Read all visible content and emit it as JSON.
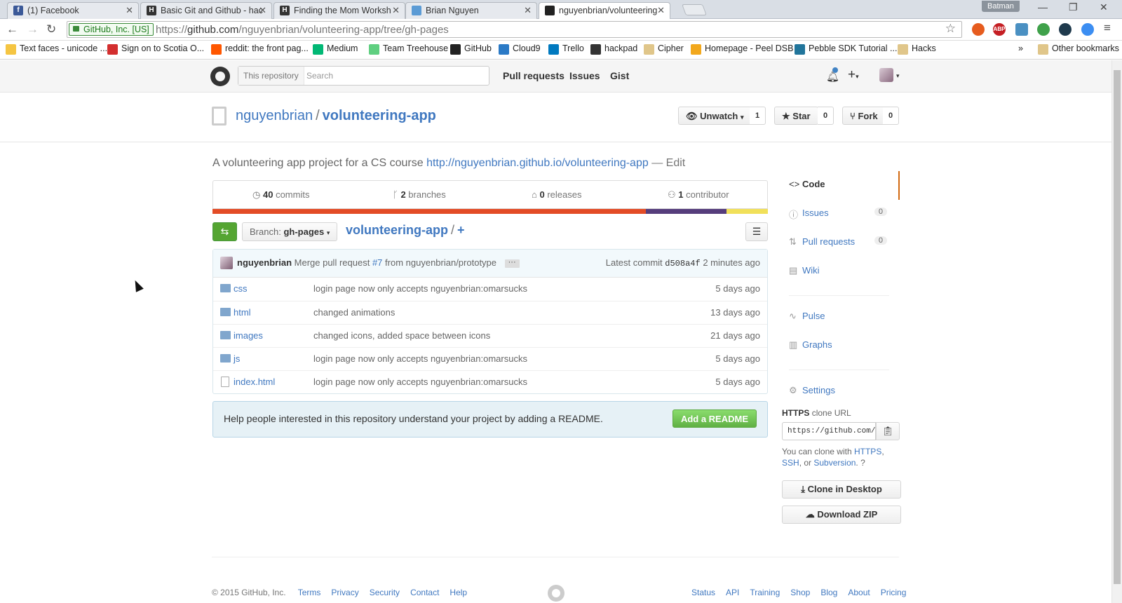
{
  "browser": {
    "tabs": [
      {
        "title": "(1) Facebook",
        "favicon": "facebook-icon",
        "color": "#3b5998",
        "glyph": "f"
      },
      {
        "title": "Basic Git and Github - hac",
        "favicon": "hackpad-icon",
        "color": "#333333",
        "glyph": "H"
      },
      {
        "title": "Finding the Mom Worksh",
        "favicon": "hackpad-icon",
        "color": "#333333",
        "glyph": "H"
      },
      {
        "title": "Brian Nguyen",
        "favicon": "photo-icon",
        "color": "#5b9bd5",
        "glyph": ""
      },
      {
        "title": "nguyenbrian/volunteering",
        "favicon": "github-icon",
        "color": "#222222",
        "glyph": ""
      }
    ],
    "profile_name": "Batman",
    "secure_label": "GitHub, Inc. [US]",
    "url_scheme": "https://",
    "url_host": "github.com",
    "url_path": "/nguyenbrian/volunteering-app/tree/gh-pages",
    "bookmarks": [
      {
        "label": "Text faces - unicode ...",
        "icon": "emoji-icon",
        "color": "#f5c542"
      },
      {
        "label": "Sign on to Scotia O...",
        "icon": "scotia-icon",
        "color": "#d32f2f"
      },
      {
        "label": "reddit: the front pag...",
        "icon": "reddit-icon",
        "color": "#ff5700"
      },
      {
        "label": "Medium",
        "icon": "medium-icon",
        "color": "#02b875"
      },
      {
        "label": "Team Treehouse",
        "icon": "treehouse-icon",
        "color": "#5fcf80"
      },
      {
        "label": "GitHub",
        "icon": "github-icon",
        "color": "#222222"
      },
      {
        "label": "Cloud9",
        "icon": "cloud9-icon",
        "color": "#2b7ac6"
      },
      {
        "label": "Trello",
        "icon": "trello-icon",
        "color": "#0079bf"
      },
      {
        "label": "hackpad",
        "icon": "hackpad-icon",
        "color": "#333333"
      },
      {
        "label": "Cipher",
        "icon": "folder-icon",
        "color": "#e0c68a"
      },
      {
        "label": "Homepage - Peel DSB",
        "icon": "peel-icon",
        "color": "#f2a81d"
      },
      {
        "label": "Pebble SDK Tutorial ...",
        "icon": "wordpress-icon",
        "color": "#21759b"
      },
      {
        "label": "Hacks",
        "icon": "folder-icon",
        "color": "#e0c68a"
      }
    ],
    "bookmarks_overflow": "»",
    "other_bookmarks": "Other bookmarks"
  },
  "header": {
    "search_scope": "This repository",
    "search_placeholder": "Search",
    "nav": [
      "Pull requests",
      "Issues",
      "Gist"
    ]
  },
  "repo": {
    "owner": "nguyenbrian",
    "name": "volunteering-app",
    "watch_label": "Unwatch",
    "watch_count": "1",
    "star_label": "Star",
    "star_count": "0",
    "fork_label": "Fork",
    "fork_count": "0",
    "description": "A volunteering app project for a CS course",
    "homepage": "http://nguyenbrian.github.io/volunteering-app",
    "edit_label": "— Edit"
  },
  "summary": {
    "commits_count": "40",
    "commits_label": "commits",
    "branches_count": "2",
    "branches_label": "branches",
    "releases_count": "0",
    "releases_label": "releases",
    "contributors_count": "1",
    "contributors_label": "contributor"
  },
  "languages": [
    {
      "share": 0.78,
      "color": "#e34c26"
    },
    {
      "share": 0.145,
      "color": "#563d7c"
    },
    {
      "share": 0.075,
      "color": "#f1e05a"
    }
  ],
  "file_nav": {
    "branch_prefix": "Branch:",
    "branch": "gh-pages",
    "root": "volunteering-app",
    "separator": "/",
    "add": "+"
  },
  "latest_commit": {
    "author": "nguyenbrian",
    "message_pre": "Merge pull request",
    "pr_link": "#7",
    "message_post": "from nguyenbrian/prototype",
    "ellipsis": "···",
    "label": "Latest commit",
    "sha": "d508a4f",
    "age": "2 minutes ago"
  },
  "files": [
    {
      "name": "css",
      "type": "dir",
      "message": "login page now only accepts nguyenbrian:omarsucks",
      "age": "5 days ago"
    },
    {
      "name": "html",
      "type": "dir",
      "message": "changed animations",
      "age": "13 days ago"
    },
    {
      "name": "images",
      "type": "dir",
      "message": "changed icons, added space between icons",
      "age": "21 days ago"
    },
    {
      "name": "js",
      "type": "dir",
      "message": "login page now only accepts nguyenbrian:omarsucks",
      "age": "5 days ago"
    },
    {
      "name": "index.html",
      "type": "file",
      "message": "login page now only accepts nguyenbrian:omarsucks",
      "age": "5 days ago"
    }
  ],
  "readme_prompt": {
    "text": "Help people interested in this repository understand your project by adding a README.",
    "button": "Add a README"
  },
  "sidebar": {
    "items": [
      {
        "label": "Code",
        "icon": "code-icon",
        "glyph": "<>",
        "count": ""
      },
      {
        "label": "Issues",
        "icon": "issue-icon",
        "glyph": "ⓘ",
        "count": "0"
      },
      {
        "label": "Pull requests",
        "icon": "pull-request-icon",
        "glyph": "⇅",
        "count": "0"
      },
      {
        "label": "Wiki",
        "icon": "wiki-icon",
        "glyph": "▤",
        "count": ""
      },
      {
        "label": "Pulse",
        "icon": "pulse-icon",
        "glyph": "∿",
        "count": ""
      },
      {
        "label": "Graphs",
        "icon": "graph-icon",
        "glyph": "▥",
        "count": ""
      },
      {
        "label": "Settings",
        "icon": "gear-icon",
        "glyph": "⚙",
        "count": ""
      }
    ],
    "clone_protocol": "HTTPS",
    "clone_label": "clone URL",
    "clone_url": "https://github.com/nguyenbrian/volunteering-app.git",
    "clone_help_pre": "You can clone with",
    "clone_https": "HTTPS",
    "clone_ssh": "SSH",
    "clone_or": ", or",
    "clone_svn": "Subversion",
    "clone_desktop": "Clone in Desktop",
    "download_zip": "Download ZIP"
  },
  "footer": {
    "copyright": "© 2015 GitHub, Inc.",
    "left_links": [
      "Terms",
      "Privacy",
      "Security",
      "Contact",
      "Help"
    ],
    "right_links": [
      "Status",
      "API",
      "Training",
      "Shop",
      "Blog",
      "About",
      "Pricing"
    ]
  }
}
